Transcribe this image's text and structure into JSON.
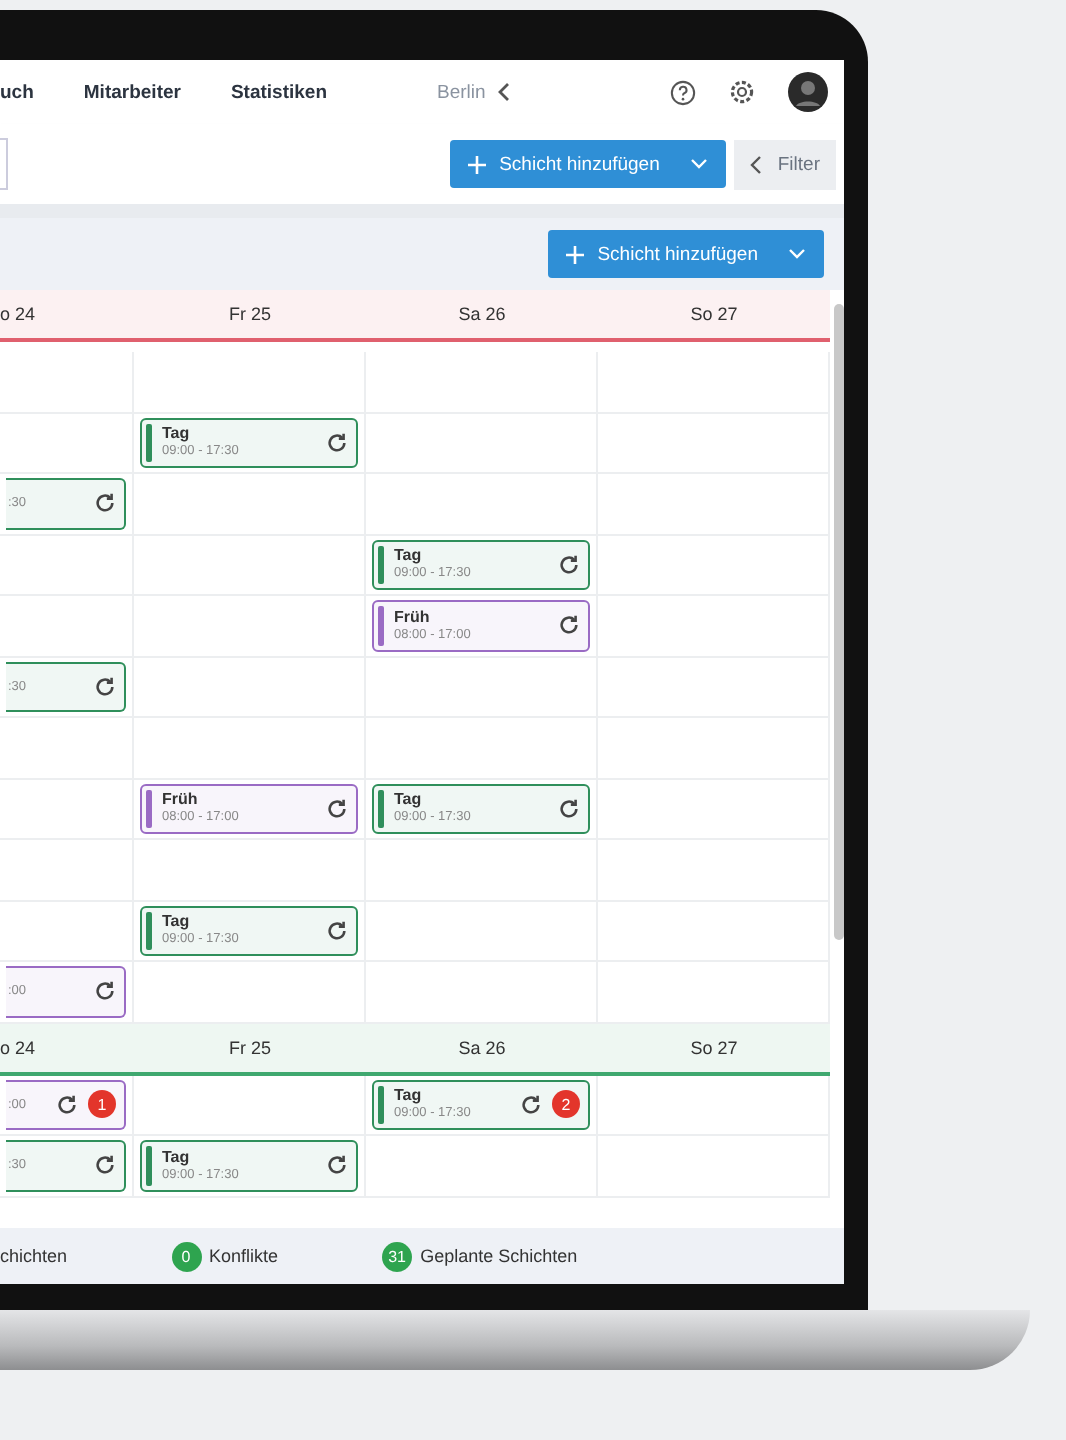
{
  "nav": {
    "items": [
      {
        "label": "uch"
      },
      {
        "label": "Mitarbeiter"
      },
      {
        "label": "Statistiken"
      }
    ],
    "location": "Berlin"
  },
  "toolbar": {
    "add_button": "Schicht hinzufügen",
    "filter_button": "Filter"
  },
  "panel": {
    "add_button": "Schicht hinzufügen"
  },
  "weeks": [
    {
      "color": "#e0606e",
      "days": [
        "o 24",
        "Fr 25",
        "Sa 26",
        "So 27"
      ],
      "rows": [
        {
          "cells": [
            {},
            {},
            {},
            {}
          ]
        },
        {
          "cells": [
            {},
            {
              "kind": "full",
              "title": "Tag",
              "time": "09:00 - 17:30",
              "color": "#2f8f5b"
            },
            {},
            {}
          ]
        },
        {
          "cells": [
            {
              "kind": "partial",
              "time": ":30",
              "color": "#2f8f5b"
            },
            {},
            {},
            {}
          ]
        },
        {
          "cells": [
            {},
            {},
            {
              "kind": "full",
              "title": "Tag",
              "time": "09:00 - 17:30",
              "color": "#2f8f5b"
            },
            {}
          ]
        },
        {
          "cells": [
            {},
            {},
            {
              "kind": "full",
              "title": "Früh",
              "time": "08:00 - 17:00",
              "color": "#9a6bc4"
            },
            {}
          ]
        },
        {
          "cells": [
            {
              "kind": "partial",
              "time": ":30",
              "color": "#2f8f5b"
            },
            {},
            {},
            {}
          ]
        },
        {
          "cells": [
            {},
            {},
            {},
            {}
          ]
        },
        {
          "cells": [
            {},
            {
              "kind": "full",
              "title": "Früh",
              "time": "08:00 - 17:00",
              "color": "#9a6bc4"
            },
            {
              "kind": "full",
              "title": "Tag",
              "time": "09:00 - 17:30",
              "color": "#2f8f5b"
            },
            {}
          ]
        },
        {
          "cells": [
            {},
            {},
            {},
            {}
          ]
        },
        {
          "cells": [
            {},
            {
              "kind": "full",
              "title": "Tag",
              "time": "09:00 - 17:30",
              "color": "#2f8f5b"
            },
            {},
            {}
          ]
        },
        {
          "cells": [
            {
              "kind": "partial",
              "time": ":00",
              "color": "#9a6bc4"
            },
            {},
            {},
            {}
          ]
        }
      ]
    },
    {
      "color": "#3fa86f",
      "days": [
        "o 24",
        "Fr 25",
        "Sa 26",
        "So 27"
      ],
      "rows": [
        {
          "cells": [
            {
              "kind": "partial",
              "time": ":00",
              "color": "#9a6bc4",
              "badge": "1"
            },
            {},
            {
              "kind": "full",
              "title": "Tag",
              "time": "09:00 - 17:30",
              "color": "#2f8f5b",
              "badge": "2"
            },
            {}
          ]
        },
        {
          "cells": [
            {
              "kind": "partial",
              "time": ":30",
              "color": "#2f8f5b"
            },
            {
              "kind": "full",
              "title": "Tag",
              "time": "09:00 - 17:30",
              "color": "#2f8f5b"
            },
            {},
            {}
          ]
        }
      ]
    }
  ],
  "summary": [
    {
      "label": "chichten"
    },
    {
      "count": "0",
      "label": "Konflikte"
    },
    {
      "count": "31",
      "label": "Geplante Schichten"
    }
  ]
}
